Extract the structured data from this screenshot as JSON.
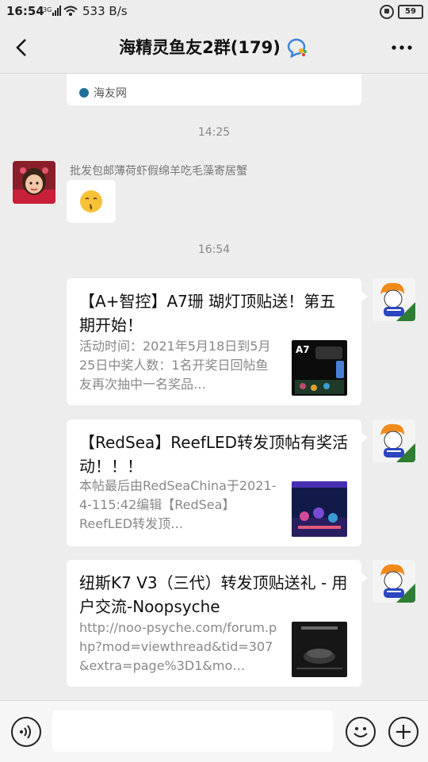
{
  "status_bar": {
    "time": "16:54",
    "network": "3G",
    "speed": "533 B/s",
    "battery": "59"
  },
  "header": {
    "title": "海精灵鱼友2群(179)",
    "back_icon": "back-arrow-icon",
    "more_icon": "more-dots-icon"
  },
  "chat": {
    "partial_card": {
      "source": "海友网"
    },
    "timestamp_1": "14:25",
    "message_1": {
      "sender": "批发包邮薄荷虾假绵羊吃毛藻寄居蟹",
      "content": "emoji"
    },
    "timestamp_2": "16:54",
    "cards": [
      {
        "title": "【A+智控】A7珊 瑚灯顶贴送！第五期开始！",
        "description": "活动时间：2021年5月18日到5月25日中奖人数：1名开奖日回帖鱼友再次抽中一名奖品…",
        "thumb_label": "A7"
      },
      {
        "title": "【RedSea】ReefLED转发顶帖有奖活动！！！",
        "description": "本帖最后由RedSeaChina于2021-4-115:42编辑【RedSea】ReefLED转发顶…"
      },
      {
        "title": "纽斯K7 V3（三代）转发顶贴送礼 - 用户交流-Noopsyche",
        "description": "http://noo-psyche.com/forum.php?mod=viewthread&tid=307&extra=page%3D1&mo…"
      }
    ]
  },
  "input_bar": {
    "voice_icon": "voice-icon",
    "emoji_icon": "emoji-icon",
    "plus_icon": "plus-icon"
  }
}
